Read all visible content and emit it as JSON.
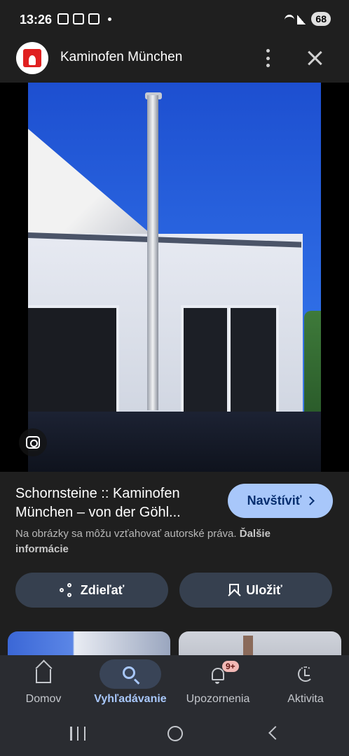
{
  "status_bar": {
    "time": "13:26",
    "battery": "68"
  },
  "header": {
    "site_title": "Kaminofen München",
    "logo_icon": "flame-logo-icon",
    "more_icon": "more-vert-icon",
    "close_icon": "close-icon"
  },
  "image_viewer": {
    "lens_icon": "google-lens-icon"
  },
  "result": {
    "title": "Schornsteine :: Kaminofen München – von der Göhl...",
    "visit_label": "Navštíviť",
    "copyright_notice": "Na obrázky sa môžu vzťahovať autorské práva.",
    "more_info_label": "Ďalšie informácie",
    "share_label": "Zdieľať",
    "save_label": "Uložiť"
  },
  "bottom_nav": {
    "items": [
      {
        "label": "Domov",
        "icon": "home-icon",
        "active": false
      },
      {
        "label": "Vyhľadávanie",
        "icon": "search-icon",
        "active": true
      },
      {
        "label": "Upozornenia",
        "icon": "bell-icon",
        "active": false,
        "badge": "9+"
      },
      {
        "label": "Aktivita",
        "icon": "activity-icon",
        "active": false
      }
    ]
  },
  "colors": {
    "background": "#1f1f1f",
    "accent": "#a8c7fa",
    "button_bg": "#36404f",
    "nav_bg": "#2a2c31"
  }
}
